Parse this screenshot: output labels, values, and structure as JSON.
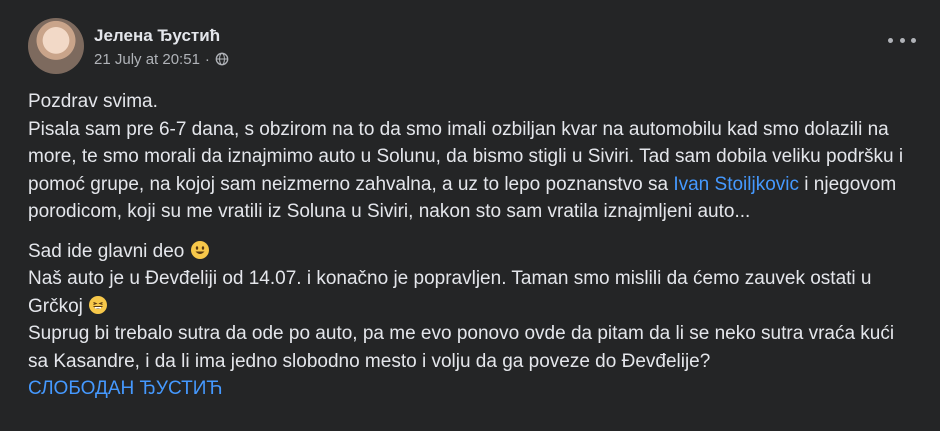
{
  "post": {
    "author": "Јелена Ђустић",
    "timestamp": "21 July at 20:51",
    "separator": "·",
    "privacy_icon": "globe-icon",
    "more_icon": "more-options-icon",
    "p1": "Pozdrav svima.",
    "p2": "Pisala sam pre 6-7 dana, s obzirom na to da smo imali ozbiljan kvar na automobilu kad smo dolazili na more, te smo morali da iznajmimo auto u Solunu, da bismo stigli u Siviri. Tad sam dobila veliku podršku i pomoć grupe, na kojoj sam neizmerno zahvalna, a uz to lepo poznanstvo sa",
    "mention1": "Ivan Stoiljkovic",
    "p2_end": " i njegovom porodicom, koji su me vratili iz Soluna u Siviri, nakon sto sam vratila iznajmljeni auto...",
    "p3": "Sad ide glavni deo",
    "p4": "Naš auto je u Đevđeliji od 14.07. i konačno je popravljen. Taman smo mislili da ćemo zauvek ostati u Grčkoj",
    "p5": "Suprug bi trebalo sutra da ode po auto, pa me evo ponovo ovde da pitam da li se neko sutra vraća kući sa Kasandre, i da li ima jedno slobodno mesto i volju da ga poveze do Đevđelije?",
    "mention2": "СЛОБОДАН ЂУСТИЋ"
  },
  "colors": {
    "background": "#242526",
    "text": "#e4e6eb",
    "secondary_text": "#b0b3b8",
    "link": "#4599ff",
    "emoji": "#f7c84a"
  },
  "emojis": [
    "smiling-face-emoji",
    "grinning-face-emoji"
  ]
}
